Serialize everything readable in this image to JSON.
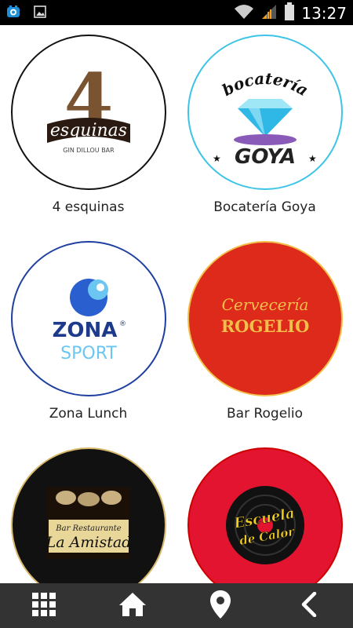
{
  "status_bar": {
    "time": "13:27",
    "icons": [
      "app-notification-icon",
      "image-notification-icon",
      "wifi-icon",
      "signal-icon",
      "battery-icon"
    ]
  },
  "restaurants": [
    {
      "name": "4 esquinas",
      "logo": {
        "number": "4",
        "script": "esquinas",
        "tagline": "GIN DILLOU BAR"
      }
    },
    {
      "name": "Bocatería Goya",
      "logo": {
        "top": "bocatería",
        "bottom": "GOYA"
      }
    },
    {
      "name": "Zona Lunch",
      "logo": {
        "line1": "ZONA",
        "mark": "®",
        "line2": "SPORT"
      }
    },
    {
      "name": "Bar Rogelio",
      "logo": {
        "line1": "Cervecería",
        "line2": "ROGELIO"
      }
    },
    {
      "name": "",
      "logo": {
        "line1": "Bar Restaurante",
        "line2": "La Amistad"
      }
    },
    {
      "name": "",
      "logo": {
        "line1": "Escuela",
        "line2": "de Calor"
      }
    }
  ],
  "bottom_nav": [
    "grid-menu-icon",
    "home-icon",
    "location-pin-icon",
    "back-chevron-icon"
  ],
  "colors": {
    "status_bar": "#000000",
    "nav_bar": "#333333",
    "goya_ring": "#3cc4e6",
    "zona_ring": "#1e3fa0",
    "rogelio_red": "#dd2a1b",
    "rogelio_gold": "#f2c04a",
    "escuela_red": "#e2142f"
  }
}
